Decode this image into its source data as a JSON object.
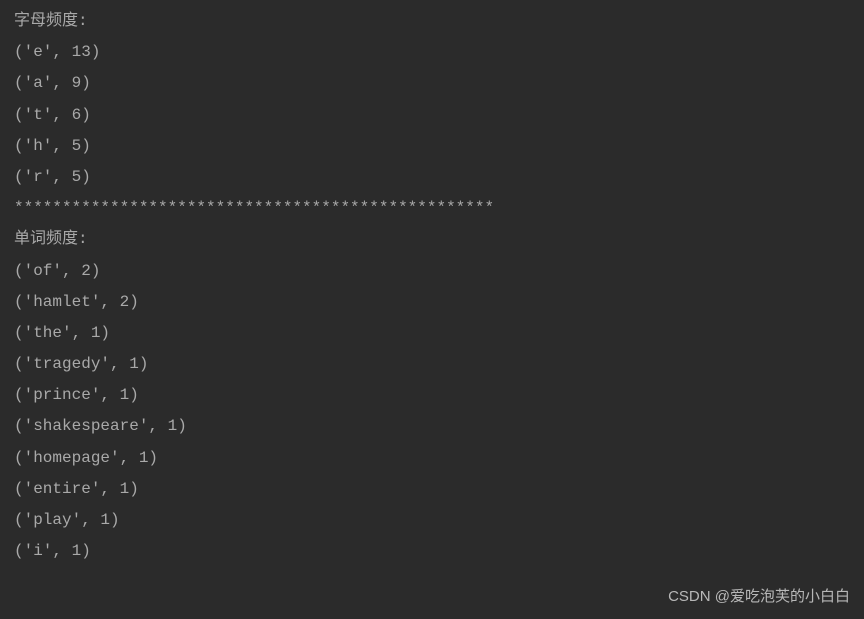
{
  "output": {
    "letter_freq_header": "字母频度:",
    "letter_entries": [
      "('e', 13)",
      "('a', 9)",
      "('t', 6)",
      "('h', 5)",
      "('r', 5)"
    ],
    "separator": "**************************************************",
    "word_freq_header": "单词频度:",
    "word_entries": [
      "('of', 2)",
      "('hamlet', 2)",
      "('the', 1)",
      "('tragedy', 1)",
      "('prince', 1)",
      "('shakespeare', 1)",
      "('homepage', 1)",
      "('entire', 1)",
      "('play', 1)",
      "('i', 1)"
    ]
  },
  "watermark": "CSDN @爱吃泡芙的小白白"
}
